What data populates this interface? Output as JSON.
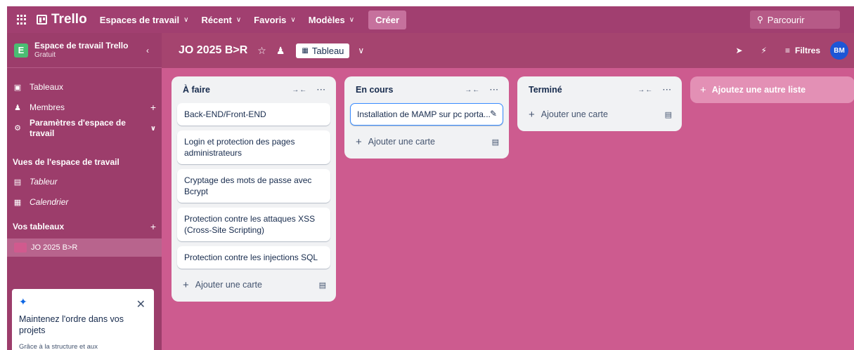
{
  "topbar": {
    "app_name": "Trello",
    "nav": [
      {
        "label": "Espaces de travail"
      },
      {
        "label": "Récent"
      },
      {
        "label": "Favoris"
      },
      {
        "label": "Modèles"
      }
    ],
    "create_label": "Créer",
    "search_placeholder": "Parcourir"
  },
  "sidebar": {
    "workspace_badge": "E",
    "workspace_name": "Espace de travail Trello",
    "workspace_plan": "Gratuit",
    "items": [
      {
        "label": "Tableaux",
        "icon": "board-icon"
      },
      {
        "label": "Membres",
        "icon": "members-icon"
      },
      {
        "label": "Paramètres d'espace de travail",
        "icon": "settings-icon"
      }
    ],
    "views_heading": "Vues de l'espace de travail",
    "views": [
      {
        "label": "Tableur",
        "icon": "table-icon"
      },
      {
        "label": "Calendrier",
        "icon": "calendar-icon"
      }
    ],
    "boards_heading": "Vos tableaux",
    "boards": [
      {
        "label": "JO 2025 B>R"
      }
    ],
    "promo": {
      "title": "Maintenez l'ordre dans vos projets",
      "body": "Grâce à la structure et aux"
    }
  },
  "board": {
    "title": "JO 2025 B>R",
    "view_label": "Tableau",
    "filters_label": "Filtres",
    "avatar_initials": "BM"
  },
  "lists": [
    {
      "title": "À faire",
      "cards": [
        "Back-END/Front-END",
        "Login et protection des pages administrateurs",
        "Cryptage des mots de passe avec Bcrypt",
        "Protection contre les attaques XSS (Cross-Site Scripting)",
        "Protection contre les injections SQL"
      ],
      "add_label": "Ajouter une carte"
    },
    {
      "title": "En cours",
      "cards": [
        "Installation de MAMP sur pc porta..."
      ],
      "add_label": "Ajouter une carte"
    },
    {
      "title": "Terminé",
      "cards": [],
      "add_label": "Ajouter une carte"
    }
  ],
  "add_list_label": "Ajoutez une autre liste",
  "colors": {
    "topbar": "#a13f70",
    "sidebar": "#9c3d6b",
    "canvas": "#cd5b8f",
    "accent": "#388bff"
  }
}
